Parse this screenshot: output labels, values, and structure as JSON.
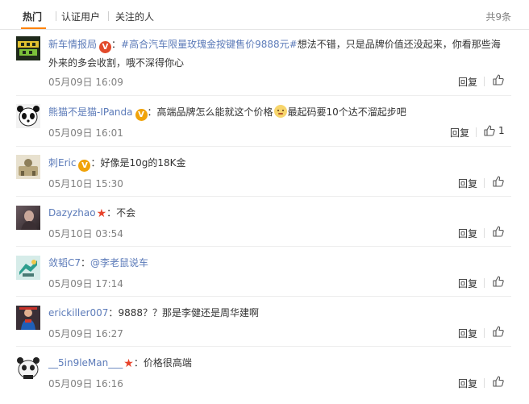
{
  "tabs": [
    "热门",
    "认证用户",
    "关注的人"
  ],
  "total_label": "共9条",
  "reply_label": "回复",
  "comments": [
    {
      "user": "新车情报局",
      "badge": "V",
      "topic": "#高合汽车限量玫瑰金按键售价9888元#",
      "text": "想法不错，只是品牌价值还没起来，你看那些海外来的多会收割，哦不深得你心",
      "time": "05月09日 16:09",
      "likes": ""
    },
    {
      "user": "熊猫不是猫-IPanda",
      "badge": "V",
      "text_before": "高端品牌怎么能就这个价格",
      "text_after": "最起码要10个达不溜起步吧",
      "time": "05月09日 16:01",
      "likes": "1"
    },
    {
      "user": "刺Eric",
      "badge": "V",
      "text": "好像是10g的18K金",
      "time": "05月10日 15:30",
      "likes": ""
    },
    {
      "user": "Dazyzhao",
      "text": "不会",
      "time": "05月10日 03:54",
      "likes": ""
    },
    {
      "user": "敛韬C7",
      "mention": "@李老鼠说车",
      "time": "05月09日 17:14",
      "likes": ""
    },
    {
      "user": "erickiller007",
      "text": "9888？？那是李健还是周华建啊",
      "time": "05月09日 16:27",
      "likes": ""
    },
    {
      "user": "__5in9leMan___",
      "text": "价格很高端",
      "time": "05月09日 16:16",
      "likes": ""
    }
  ],
  "colors": {
    "username": "#5c7bb9",
    "topic": "#5c7bb9",
    "badge_gold": "#f0a30a",
    "star_red": "#e8432b",
    "tab_underline": "#ff8200"
  }
}
